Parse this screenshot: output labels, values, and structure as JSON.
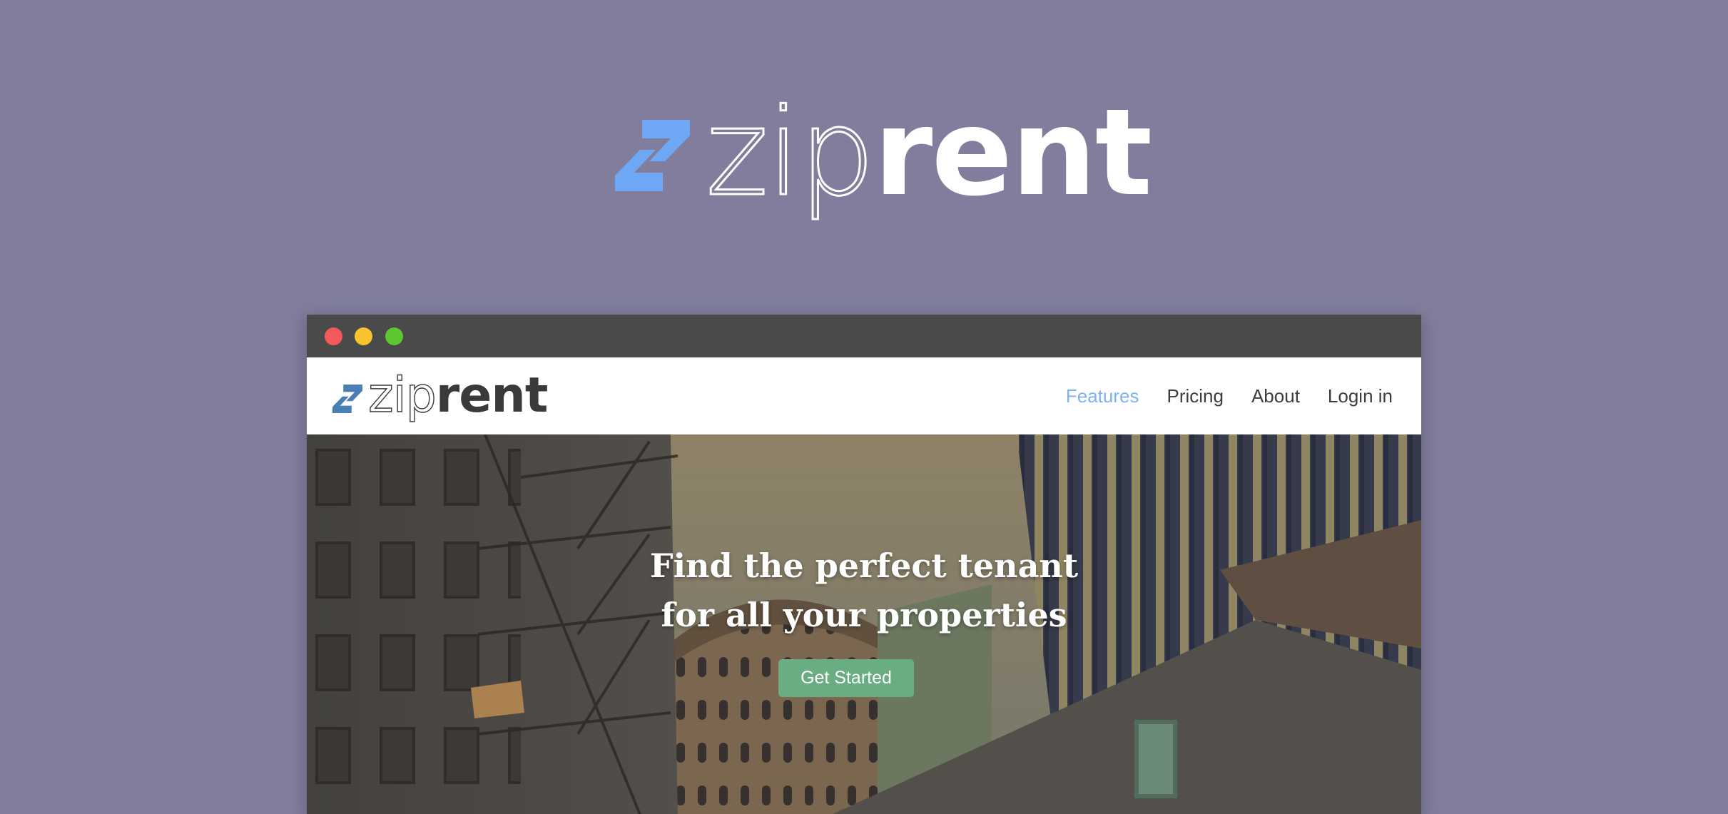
{
  "colors": {
    "background": "#807d9d",
    "brand_blue": "#6ea8f5",
    "nav_active": "#7fb2ee",
    "cta_green": "#6aad82",
    "titlebar": "#4a4a4a"
  },
  "hero_logo": {
    "text_light": "zip",
    "text_bold": "rent",
    "icon": "ziprent-arrows-icon"
  },
  "browser": {
    "window_controls": [
      "close",
      "minimize",
      "maximize"
    ],
    "nav": {
      "logo_light": "zip",
      "logo_bold": "rent",
      "links": [
        {
          "label": "Features",
          "active": true
        },
        {
          "label": "Pricing",
          "active": false
        },
        {
          "label": "About",
          "active": false
        },
        {
          "label": "Login in",
          "active": false
        }
      ]
    },
    "hero": {
      "headline_line1": "Find the perfect tenant",
      "headline_line2": "for all your properties",
      "cta_label": "Get Started"
    }
  }
}
